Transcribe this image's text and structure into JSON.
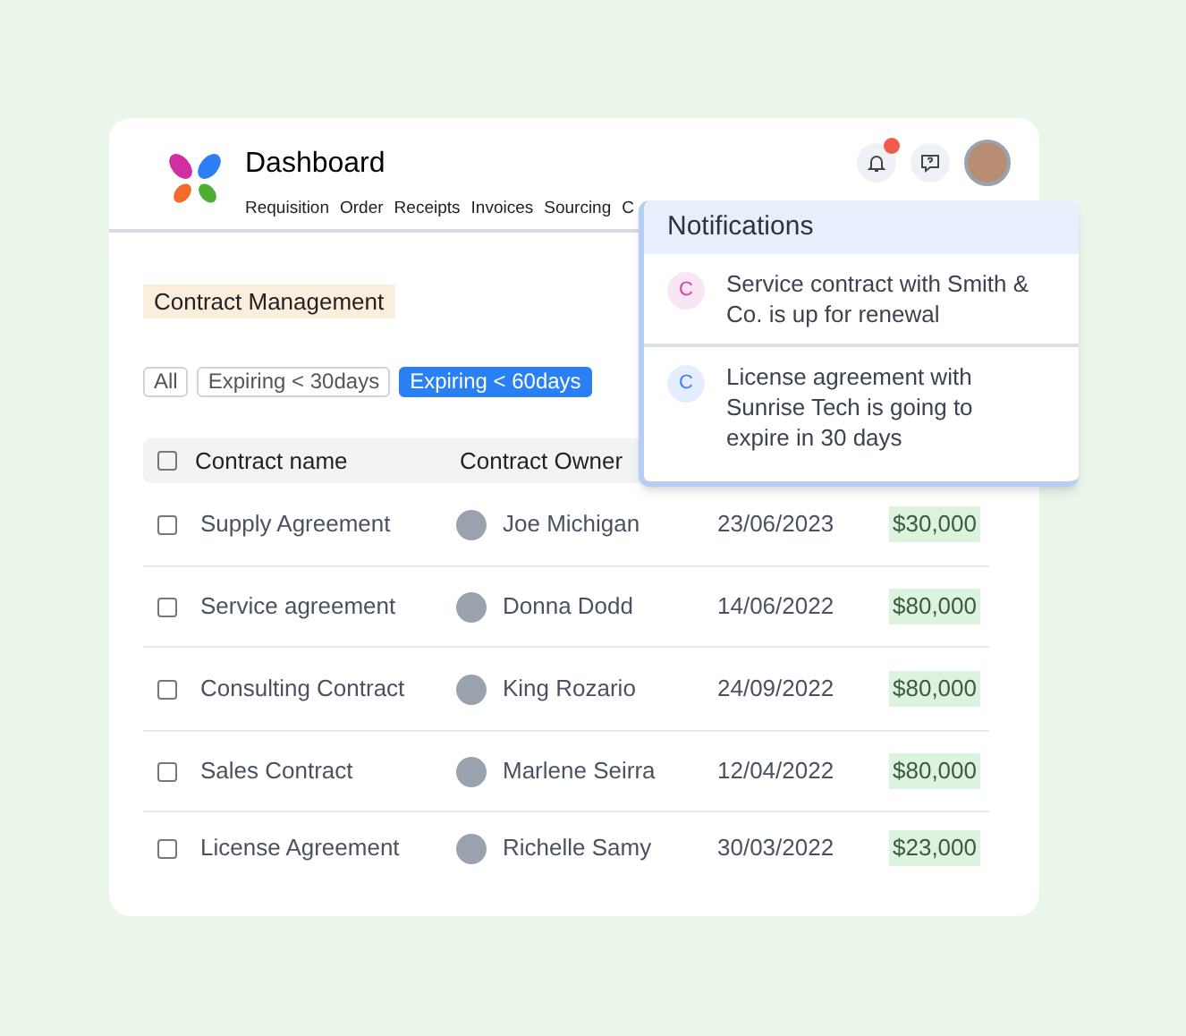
{
  "header": {
    "title": "Dashboard",
    "nav": [
      {
        "label": "Requisition"
      },
      {
        "label": "Order"
      },
      {
        "label": "Receipts"
      },
      {
        "label": "Invoices"
      },
      {
        "label": "Sourcing"
      },
      {
        "label": "C"
      }
    ],
    "bell_unread": true
  },
  "section_tag": "Contract Management",
  "filters": [
    {
      "label": "All",
      "selected": false
    },
    {
      "label": "Expiring < 30days",
      "selected": false
    },
    {
      "label": "Expiring < 60days",
      "selected": true
    }
  ],
  "table": {
    "select_all_checked": false,
    "columns": [
      "Contract name",
      "Contract Owner"
    ],
    "rows": [
      {
        "checked": false,
        "name": "Supply Agreement",
        "owner": "Joe Michigan",
        "date": "23/06/2023",
        "amount": "$30,000"
      },
      {
        "checked": false,
        "name": "Service agreement",
        "owner": "Donna Dodd",
        "date": "14/06/2022",
        "amount": "$80,000"
      },
      {
        "checked": false,
        "name": "Consulting Contract",
        "owner": "King Rozario",
        "date": "24/09/2022",
        "amount": "$80,000"
      },
      {
        "checked": false,
        "name": "Sales Contract",
        "owner": "Marlene Seirra",
        "date": "12/04/2022",
        "amount": "$80,000"
      },
      {
        "checked": false,
        "name": "License Agreement",
        "owner": "Richelle Samy",
        "date": "30/03/2022",
        "amount": "$23,000"
      }
    ]
  },
  "notifications": {
    "title": "Notifications",
    "items": [
      {
        "initial": "C",
        "color": "#d63fae",
        "text": "Service contract with Smith & Co. is up for renewal"
      },
      {
        "initial": "C",
        "color": "#3b82f6",
        "text": "License agreement with Sunrise Tech is going to expire in 30 days"
      }
    ]
  }
}
